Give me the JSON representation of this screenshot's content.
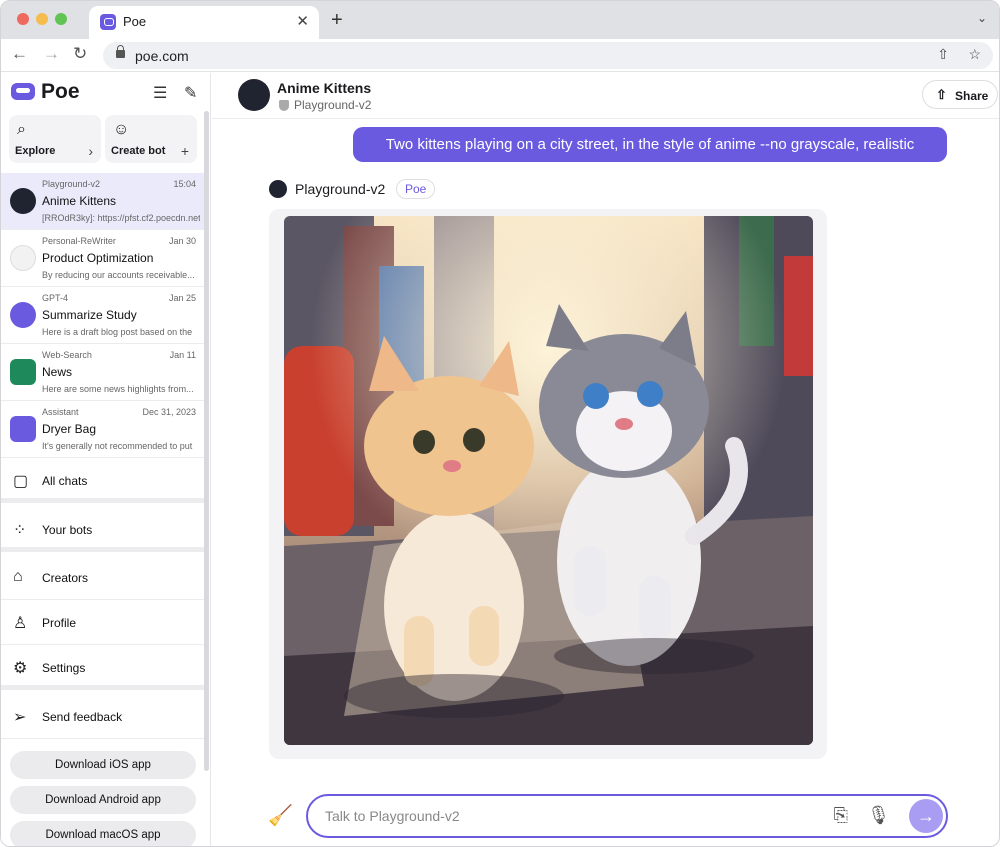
{
  "browser": {
    "tab_title": "Poe",
    "tab_close": "✕",
    "new_tab": "+",
    "menu_chevron": "⌄",
    "url": "poe.com",
    "back": "←",
    "forward": "→",
    "reload": "↻",
    "share_icon": "⇧",
    "bookmark_icon": "☆"
  },
  "sidebar": {
    "brand": "Poe",
    "explore_label": "Explore",
    "create_bot_label": "Create bot",
    "chats": [
      {
        "bot": "Playground-v2",
        "date": "15:04",
        "title": "Anime Kittens",
        "preview": "[RROdR3ky]: https://pfst.cf2.poecdn.net",
        "avatar_color": "#1f2430",
        "selected": true
      },
      {
        "bot": "Personal-ReWriter",
        "date": "Jan 30",
        "title": "Product Optimization",
        "preview": "By reducing our accounts receivable...",
        "avatar_color": "#f2f2f2"
      },
      {
        "bot": "GPT-4",
        "date": "Jan 25",
        "title": "Summarize Study",
        "preview": "Here is a draft blog post based on the",
        "avatar_color": "#6a5ae0"
      },
      {
        "bot": "Web-Search",
        "date": "Jan 11",
        "title": "News",
        "preview": "Here are some news highlights from...",
        "avatar_color": "#1e8a5b"
      },
      {
        "bot": "Assistant",
        "date": "Dec 31, 2023",
        "title": "Dryer Bag",
        "preview": "It's generally not recommended to put",
        "avatar_color": "#6a5ae0"
      }
    ],
    "menu": [
      {
        "label": "All chats",
        "icon": "chat-bubbles-icon"
      },
      {
        "label": "Your bots",
        "icon": "grid-icon"
      },
      {
        "label": "Creators",
        "icon": "creators-icon"
      },
      {
        "label": "Profile",
        "icon": "person-icon"
      },
      {
        "label": "Settings",
        "icon": "gear-icon"
      },
      {
        "label": "Send feedback",
        "icon": "send-icon"
      }
    ],
    "downloads": [
      "Download iOS app",
      "Download Android app",
      "Download macOS app"
    ]
  },
  "header": {
    "title": "Anime Kittens",
    "subtitle": "Playground-v2",
    "share_label": "Share"
  },
  "conversation": {
    "user_message": "Two kittens playing on a city street, in the style of anime --no grayscale, realistic",
    "bot_name": "Playground-v2",
    "bot_badge": "Poe"
  },
  "composer": {
    "placeholder": "Talk to Playground-v2"
  },
  "colors": {
    "accent": "#6a5ae0",
    "sidebar_selected": "#ebeafb"
  }
}
